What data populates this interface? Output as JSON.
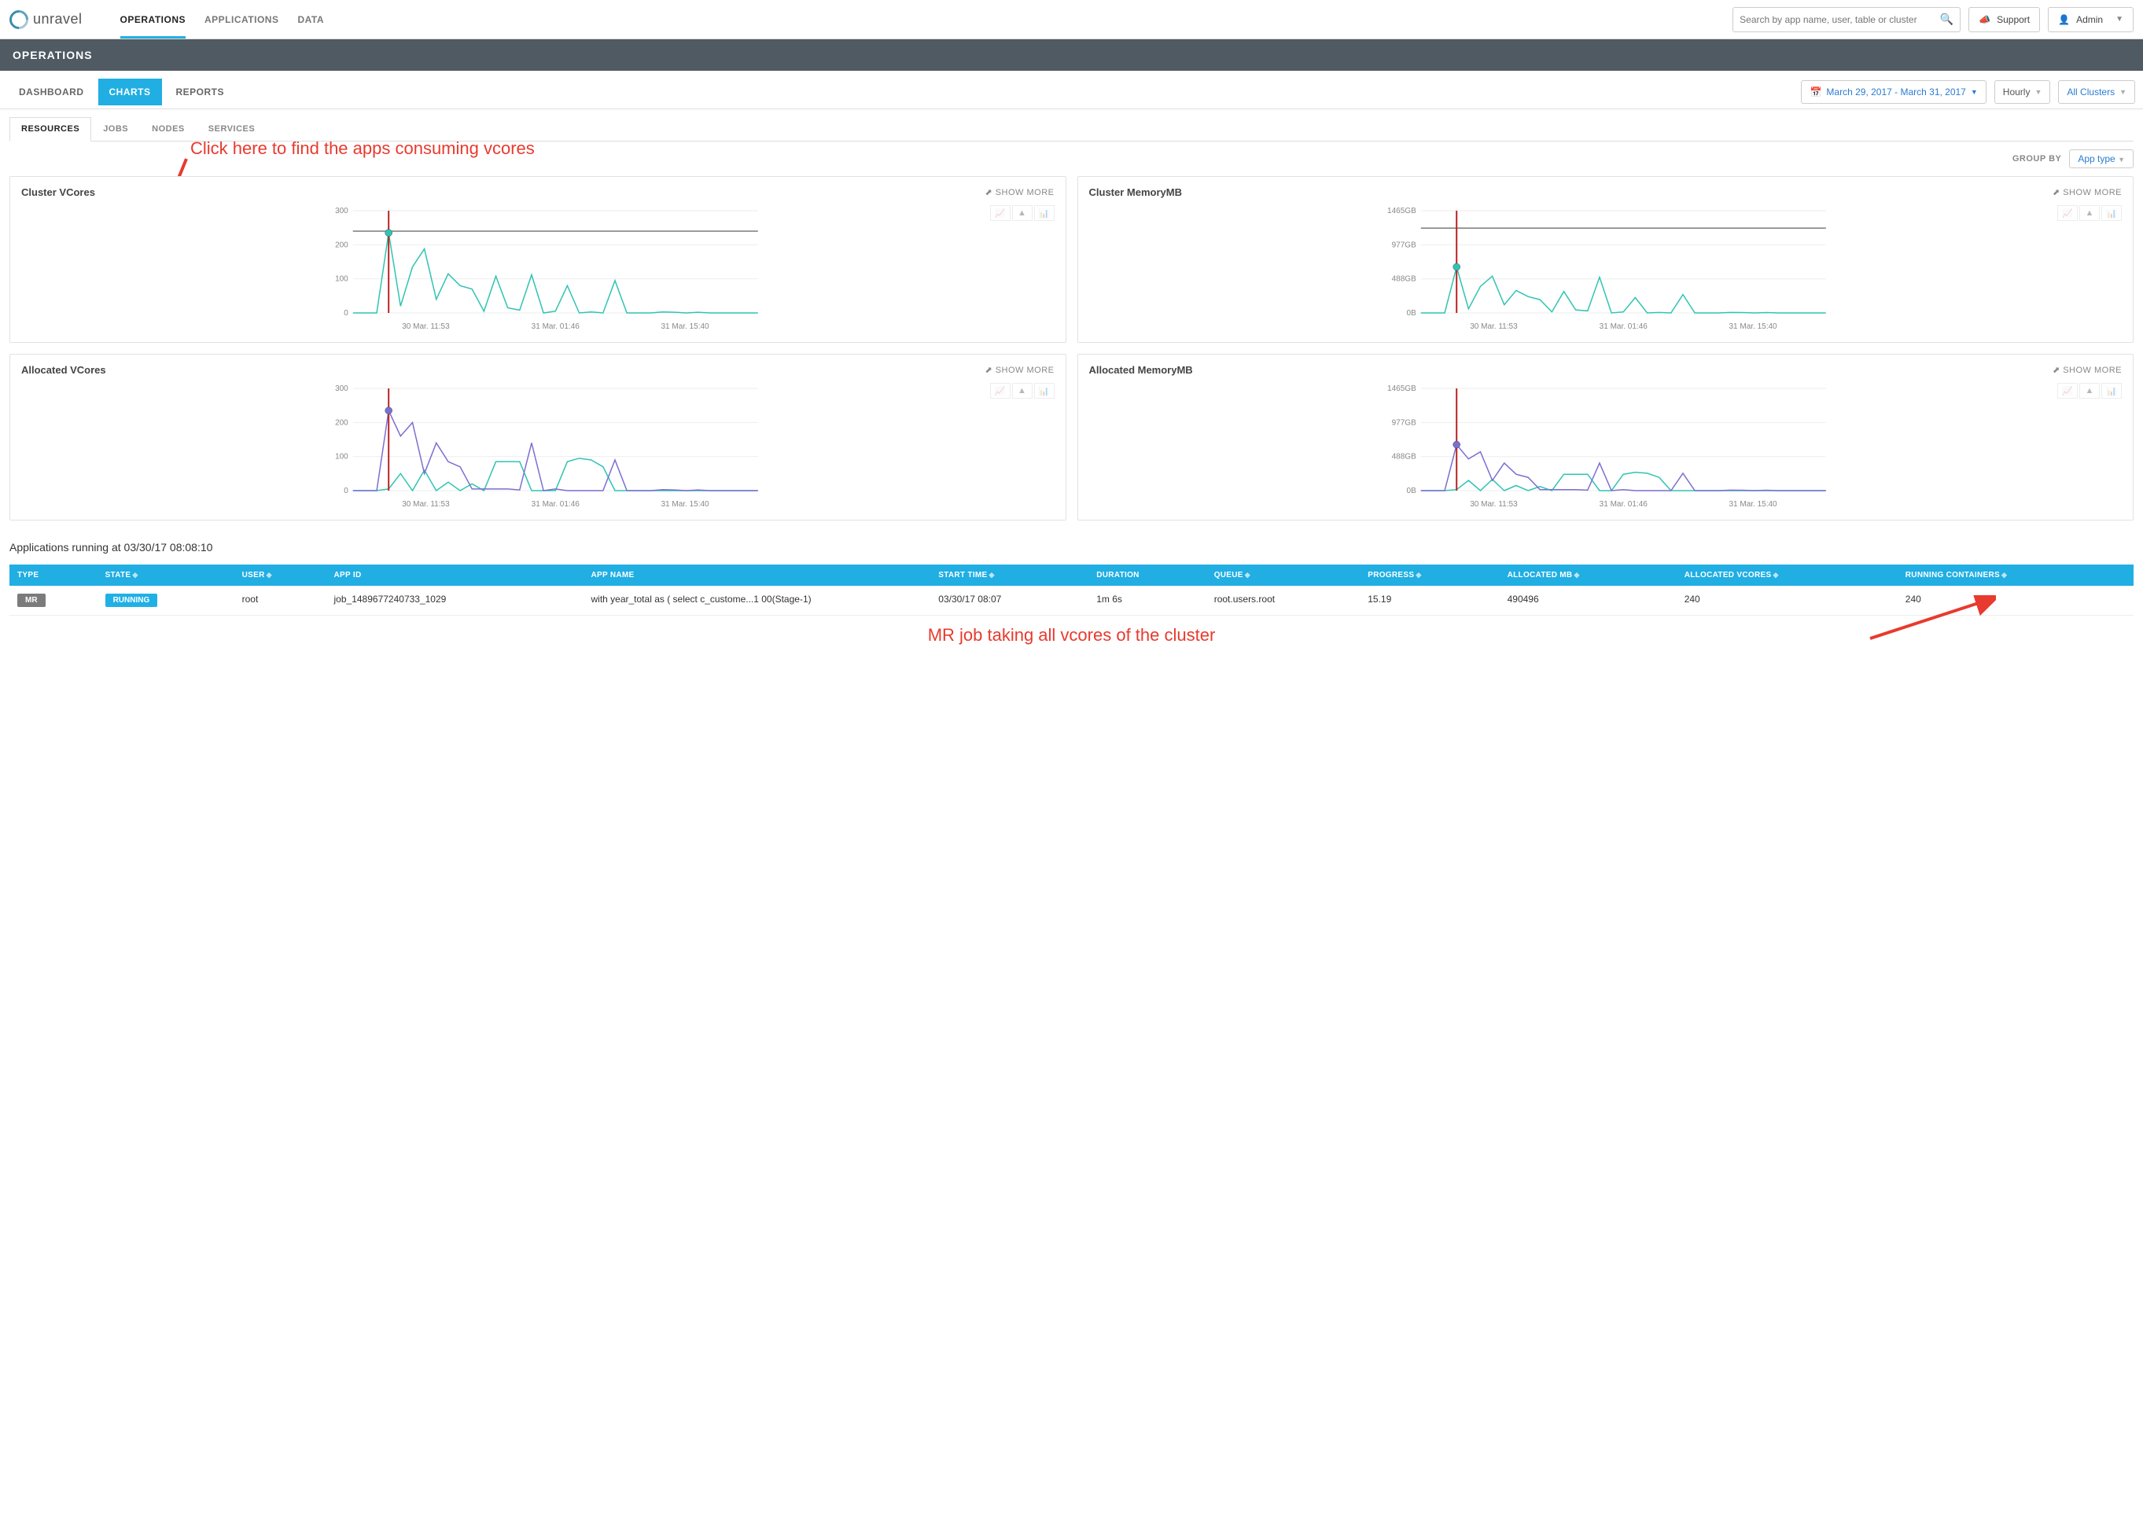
{
  "brand": "unravel",
  "topnav": {
    "operations": "OPERATIONS",
    "applications": "APPLICATIONS",
    "data": "DATA"
  },
  "search": {
    "placeholder": "Search by app name, user, table or cluster"
  },
  "support_label": "Support",
  "admin_label": "Admin",
  "section_title": "OPERATIONS",
  "subnav": {
    "dashboard": "DASHBOARD",
    "charts": "CHARTS",
    "reports": "REPORTS"
  },
  "date_range": "March 29, 2017 - March 31, 2017",
  "granularity": "Hourly",
  "cluster_filter": "All Clusters",
  "subtabs2": {
    "resources": "RESOURCES",
    "jobs": "JOBS",
    "nodes": "NODES",
    "services": "SERVICES"
  },
  "groupby": {
    "label": "GROUP BY",
    "value": "App type"
  },
  "annotation1": "Click here to find the apps consuming vcores",
  "annotation2": "MR job taking all vcores of the cluster",
  "show_more": "SHOW MORE",
  "charts": {
    "vcores": {
      "title": "Cluster VCores"
    },
    "mem": {
      "title": "Cluster MemoryMB"
    },
    "avcores": {
      "title": "Allocated VCores"
    },
    "amem": {
      "title": "Allocated MemoryMB"
    }
  },
  "apps_heading": "Applications running at 03/30/17 08:08:10",
  "table": {
    "headers": {
      "type": "TYPE",
      "state": "STATE",
      "user": "USER",
      "appid": "APP ID",
      "appname": "APP NAME",
      "start": "START TIME",
      "duration": "DURATION",
      "queue": "QUEUE",
      "progress": "PROGRESS",
      "allocmb": "ALLOCATED MB",
      "allocvc": "ALLOCATED VCORES",
      "runcont": "RUNNING CONTAINERS"
    },
    "row": {
      "type": "MR",
      "state": "RUNNING",
      "user": "root",
      "appid": "job_1489677240733_1029",
      "appname": "with year_total as ( select c_custome...1 00(Stage-1)",
      "start": "03/30/17 08:07",
      "duration": "1m 6s",
      "queue": "root.users.root",
      "progress": "15.19",
      "allocmb": "490496",
      "allocvc": "240",
      "runcont": "240"
    }
  },
  "chart_data": [
    {
      "type": "line",
      "title": "Cluster VCores",
      "ylim": [
        0,
        300
      ],
      "yticks": [
        0,
        100,
        200,
        300
      ],
      "xticks": [
        "30 Mar. 11:53",
        "31 Mar. 01:46",
        "31 Mar. 15:40"
      ],
      "hline": 240,
      "marker_x_index": 3,
      "marker_y": 235,
      "series": [
        {
          "name": "app",
          "color": "#2fc4b2",
          "values": [
            0,
            0,
            0,
            235,
            20,
            135,
            188,
            40,
            115,
            80,
            70,
            5,
            108,
            15,
            8,
            112,
            0,
            5,
            80,
            0,
            3,
            0,
            95,
            0,
            0,
            0,
            3,
            2,
            0,
            2,
            0,
            0,
            0,
            0,
            0
          ]
        }
      ]
    },
    {
      "type": "line",
      "title": "Cluster MemoryMB",
      "ylabels": [
        "0B",
        "488GB",
        "977GB",
        "1465GB"
      ],
      "xticks": [
        "30 Mar. 11:53",
        "31 Mar. 01:46",
        "31 Mar. 15:40"
      ],
      "hline_frac": 0.83,
      "marker_x_index": 3,
      "marker_y_frac": 0.45,
      "series": [
        {
          "name": "app",
          "color": "#2fc4b2",
          "values_frac": [
            0,
            0,
            0,
            0.45,
            0.04,
            0.26,
            0.36,
            0.08,
            0.22,
            0.16,
            0.13,
            0.01,
            0.21,
            0.03,
            0.02,
            0.35,
            0,
            0.01,
            0.15,
            0,
            0.005,
            0,
            0.18,
            0,
            0,
            0,
            0.005,
            0.004,
            0,
            0.004,
            0,
            0,
            0,
            0,
            0
          ]
        }
      ]
    },
    {
      "type": "line",
      "title": "Allocated VCores",
      "ylim": [
        0,
        300
      ],
      "yticks": [
        0,
        100,
        200,
        300
      ],
      "xticks": [
        "30 Mar. 11:53",
        "31 Mar. 01:46",
        "31 Mar. 15:40"
      ],
      "marker_x_index": 3,
      "marker_y": 235,
      "marker_color": "#7b6fd1",
      "series": [
        {
          "name": "s1",
          "color": "#2fc4b2",
          "values": [
            0,
            0,
            0,
            5,
            50,
            0,
            60,
            0,
            25,
            0,
            20,
            0,
            85,
            85,
            85,
            0,
            0,
            0,
            85,
            95,
            90,
            70,
            0,
            0,
            0,
            0,
            0,
            0,
            0,
            0,
            0,
            0,
            0,
            0,
            0
          ]
        },
        {
          "name": "s2",
          "color": "#7b6fd1",
          "values": [
            0,
            0,
            0,
            235,
            160,
            200,
            50,
            140,
            85,
            70,
            5,
            5,
            5,
            5,
            2,
            140,
            0,
            5,
            0,
            0,
            0,
            0,
            90,
            0,
            0,
            0,
            3,
            2,
            0,
            2,
            0,
            0,
            0,
            0,
            0
          ]
        }
      ]
    },
    {
      "type": "line",
      "title": "Allocated MemoryMB",
      "ylabels": [
        "0B",
        "488GB",
        "977GB",
        "1465GB"
      ],
      "xticks": [
        "30 Mar. 11:53",
        "31 Mar. 01:46",
        "31 Mar. 15:40"
      ],
      "marker_x_index": 3,
      "marker_y_frac": 0.45,
      "marker_color": "#7b6fd1",
      "series": [
        {
          "name": "s1",
          "color": "#2fc4b2",
          "values_frac": [
            0,
            0,
            0,
            0.01,
            0.1,
            0,
            0.11,
            0,
            0.05,
            0,
            0.04,
            0,
            0.16,
            0.16,
            0.16,
            0,
            0,
            0.16,
            0.18,
            0.17,
            0.13,
            0,
            0,
            0,
            0,
            0,
            0,
            0,
            0,
            0,
            0,
            0,
            0,
            0,
            0
          ]
        },
        {
          "name": "s2",
          "color": "#7b6fd1",
          "values_frac": [
            0,
            0,
            0,
            0.45,
            0.31,
            0.38,
            0.1,
            0.27,
            0.16,
            0.13,
            0.01,
            0.01,
            0.01,
            0.01,
            0.005,
            0.27,
            0,
            0.01,
            0,
            0,
            0,
            0,
            0.17,
            0,
            0,
            0,
            0.005,
            0.004,
            0,
            0.004,
            0,
            0,
            0,
            0,
            0
          ]
        }
      ]
    }
  ]
}
